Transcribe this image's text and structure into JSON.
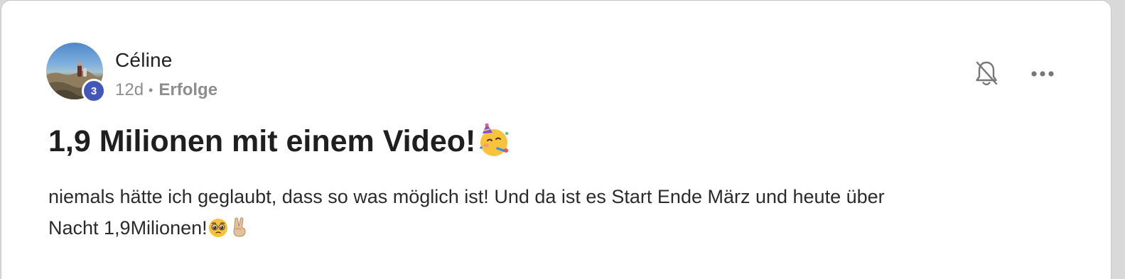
{
  "post": {
    "author": {
      "name": "Céline",
      "level": "3"
    },
    "meta": {
      "time": "12d",
      "separator": "•",
      "category": "Erfolge"
    },
    "title": "1,9 Milionen mit einem Video!",
    "title_emoji": "partying-face-emoji",
    "body_line1": "niemals hätte ich geglaubt, dass so was möglich ist! Und da ist es Start Ende März und heute über",
    "body_line2": "Nacht 1,9Milionen!",
    "body_emojis": [
      "pleading-face-emoji",
      "victory-hand-emoji"
    ]
  },
  "actions": {
    "notifications_icon": "bell-off-icon",
    "more_icon": "more-horizontal-icon"
  },
  "colors": {
    "badge": "#4257b8",
    "text": "#1f1f1f",
    "muted": "#8d8d8d",
    "icon": "#777777"
  }
}
